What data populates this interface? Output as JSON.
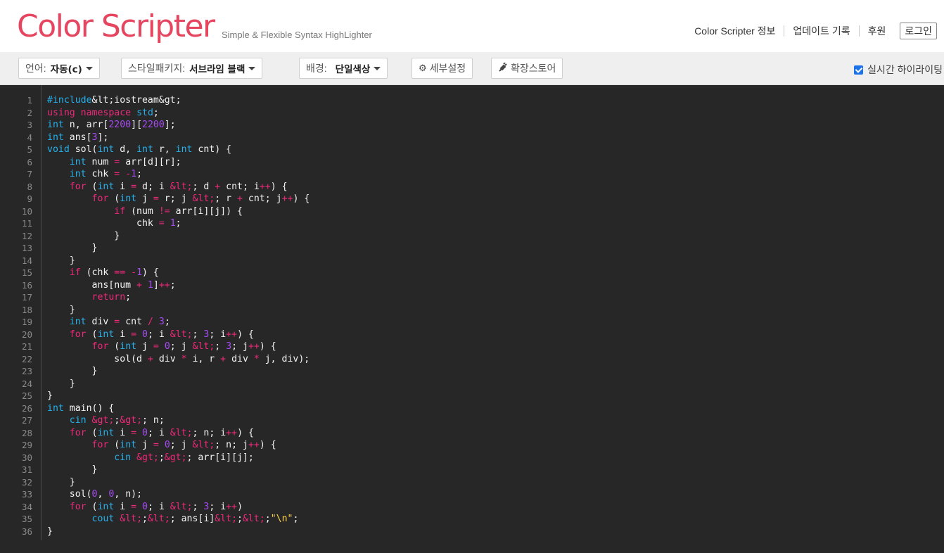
{
  "header": {
    "logo": "Color Scripter",
    "tagline": "Simple & Flexible Syntax HighLighter",
    "nav": [
      "Color Scripter 정보",
      "업데이트 기록",
      "후원"
    ],
    "login": "로그인"
  },
  "toolbar": {
    "language_label": "언어:",
    "language_value": "자동(c)",
    "style_label": "스타일패키지:",
    "style_value": "서브라임 블랙",
    "background_label": "배경:",
    "background_value": "단일색상",
    "details_label": "세부설정",
    "extension_label": "확장스토어",
    "realtime_label": "실시간 하이라이팅",
    "realtime_checked": true
  },
  "colors": {
    "brand": "#e6455f",
    "code_bg": "#272727",
    "keyword": "#f0287b",
    "type": "#26b1ec",
    "number": "#a64bf4",
    "string": "#ffd34d"
  },
  "code": {
    "line_count": 36,
    "lines": [
      [
        [
          "pp",
          "#include"
        ],
        [
          "",
          "&lt;iostream&gt;"
        ]
      ],
      [
        [
          "kw",
          "using"
        ],
        [
          "",
          " "
        ],
        [
          "kw",
          "namespace"
        ],
        [
          "",
          " "
        ],
        [
          "ty",
          "std"
        ],
        [
          "",
          ";"
        ]
      ],
      [
        [
          "ty",
          "int"
        ],
        [
          "",
          " n, arr["
        ],
        [
          "nm",
          "2200"
        ],
        [
          "",
          "]["
        ],
        [
          "nm",
          "2200"
        ],
        [
          "",
          "];"
        ]
      ],
      [
        [
          "ty",
          "int"
        ],
        [
          "",
          " ans["
        ],
        [
          "nm",
          "3"
        ],
        [
          "",
          "];"
        ]
      ],
      [
        [
          "ty",
          "void"
        ],
        [
          "",
          " sol("
        ],
        [
          "ty",
          "int"
        ],
        [
          "",
          " d, "
        ],
        [
          "ty",
          "int"
        ],
        [
          "",
          " r, "
        ],
        [
          "ty",
          "int"
        ],
        [
          "",
          " cnt) {"
        ]
      ],
      [
        [
          "",
          "    "
        ],
        [
          "ty",
          "int"
        ],
        [
          "",
          " num "
        ],
        [
          "op",
          "="
        ],
        [
          "",
          " arr[d][r];"
        ]
      ],
      [
        [
          "",
          "    "
        ],
        [
          "ty",
          "int"
        ],
        [
          "",
          " chk "
        ],
        [
          "op",
          "="
        ],
        [
          "",
          " "
        ],
        [
          "op",
          "-"
        ],
        [
          "nm",
          "1"
        ],
        [
          "",
          ";"
        ]
      ],
      [
        [
          "",
          "    "
        ],
        [
          "kw",
          "for"
        ],
        [
          "",
          " ("
        ],
        [
          "ty",
          "int"
        ],
        [
          "",
          " i "
        ],
        [
          "op",
          "="
        ],
        [
          "",
          " d; i "
        ],
        [
          "op",
          "&lt;"
        ],
        [
          "",
          ";"
        ],
        [
          "",
          " d "
        ],
        [
          "op",
          "+"
        ],
        [
          "",
          " cnt; i"
        ],
        [
          "op",
          "++"
        ],
        [
          "",
          ") {"
        ]
      ],
      [
        [
          "",
          "        "
        ],
        [
          "kw",
          "for"
        ],
        [
          "",
          " ("
        ],
        [
          "ty",
          "int"
        ],
        [
          "",
          " j "
        ],
        [
          "op",
          "="
        ],
        [
          "",
          " r; j "
        ],
        [
          "op",
          "&lt;"
        ],
        [
          "",
          "; r "
        ],
        [
          "op",
          "+"
        ],
        [
          "",
          " cnt; j"
        ],
        [
          "op",
          "++"
        ],
        [
          "",
          ") {"
        ]
      ],
      [
        [
          "",
          "            "
        ],
        [
          "kw",
          "if"
        ],
        [
          "",
          " (num "
        ],
        [
          "op",
          "!="
        ],
        [
          "",
          " arr[i][j]) {"
        ]
      ],
      [
        [
          "",
          "                chk "
        ],
        [
          "op",
          "="
        ],
        [
          "",
          " "
        ],
        [
          "nm",
          "1"
        ],
        [
          "",
          ";"
        ]
      ],
      [
        [
          "",
          "            }"
        ]
      ],
      [
        [
          "",
          "        }"
        ]
      ],
      [
        [
          "",
          "    }"
        ]
      ],
      [
        [
          "",
          "    "
        ],
        [
          "kw",
          "if"
        ],
        [
          "",
          " (chk "
        ],
        [
          "op",
          "=="
        ],
        [
          "",
          " "
        ],
        [
          "op",
          "-"
        ],
        [
          "nm",
          "1"
        ],
        [
          "",
          ") {"
        ]
      ],
      [
        [
          "",
          "        ans[num "
        ],
        [
          "op",
          "+"
        ],
        [
          "",
          " "
        ],
        [
          "nm",
          "1"
        ],
        [
          "",
          "]"
        ],
        [
          "op",
          "++"
        ],
        [
          "",
          ";"
        ]
      ],
      [
        [
          "",
          "        "
        ],
        [
          "kw",
          "return"
        ],
        [
          "",
          ";"
        ]
      ],
      [
        [
          "",
          "    }"
        ]
      ],
      [
        [
          "",
          "    "
        ],
        [
          "ty",
          "int"
        ],
        [
          "",
          " div "
        ],
        [
          "op",
          "="
        ],
        [
          "",
          " cnt "
        ],
        [
          "op",
          "/"
        ],
        [
          "",
          " "
        ],
        [
          "nm",
          "3"
        ],
        [
          "",
          ";"
        ]
      ],
      [
        [
          "",
          "    "
        ],
        [
          "kw",
          "for"
        ],
        [
          "",
          " ("
        ],
        [
          "ty",
          "int"
        ],
        [
          "",
          " i "
        ],
        [
          "op",
          "="
        ],
        [
          "",
          " "
        ],
        [
          "nm",
          "0"
        ],
        [
          "",
          "; i "
        ],
        [
          "op",
          "&lt;"
        ],
        [
          "",
          "; "
        ],
        [
          "nm",
          "3"
        ],
        [
          "",
          "; i"
        ],
        [
          "op",
          "++"
        ],
        [
          "",
          ") {"
        ]
      ],
      [
        [
          "",
          "        "
        ],
        [
          "kw",
          "for"
        ],
        [
          "",
          " ("
        ],
        [
          "ty",
          "int"
        ],
        [
          "",
          " j "
        ],
        [
          "op",
          "="
        ],
        [
          "",
          " "
        ],
        [
          "nm",
          "0"
        ],
        [
          "",
          "; j "
        ],
        [
          "op",
          "&lt;"
        ],
        [
          "",
          "; "
        ],
        [
          "nm",
          "3"
        ],
        [
          "",
          "; j"
        ],
        [
          "op",
          "++"
        ],
        [
          "",
          ") {"
        ]
      ],
      [
        [
          "",
          "            sol(d "
        ],
        [
          "op",
          "+"
        ],
        [
          "",
          " div "
        ],
        [
          "op",
          "*"
        ],
        [
          "",
          " i, r "
        ],
        [
          "op",
          "+"
        ],
        [
          "",
          " div "
        ],
        [
          "op",
          "*"
        ],
        [
          "",
          " j, div);"
        ]
      ],
      [
        [
          "",
          "        }"
        ]
      ],
      [
        [
          "",
          "    }"
        ]
      ],
      [
        [
          "",
          "}"
        ]
      ],
      [
        [
          "ty",
          "int"
        ],
        [
          "",
          " main() {"
        ]
      ],
      [
        [
          "",
          "    "
        ],
        [
          "ty",
          "cin"
        ],
        [
          "",
          " "
        ],
        [
          "op",
          "&gt;"
        ],
        [
          "",
          ";"
        ],
        [
          "op",
          "&gt;"
        ],
        [
          "",
          "; n;"
        ]
      ],
      [
        [
          "",
          "    "
        ],
        [
          "kw",
          "for"
        ],
        [
          "",
          " ("
        ],
        [
          "ty",
          "int"
        ],
        [
          "",
          " i "
        ],
        [
          "op",
          "="
        ],
        [
          "",
          " "
        ],
        [
          "nm",
          "0"
        ],
        [
          "",
          "; i "
        ],
        [
          "op",
          "&lt;"
        ],
        [
          "",
          "; n; i"
        ],
        [
          "op",
          "++"
        ],
        [
          "",
          ") {"
        ]
      ],
      [
        [
          "",
          "        "
        ],
        [
          "kw",
          "for"
        ],
        [
          "",
          " ("
        ],
        [
          "ty",
          "int"
        ],
        [
          "",
          " j "
        ],
        [
          "op",
          "="
        ],
        [
          "",
          " "
        ],
        [
          "nm",
          "0"
        ],
        [
          "",
          "; j "
        ],
        [
          "op",
          "&lt;"
        ],
        [
          "",
          "; n; j"
        ],
        [
          "op",
          "++"
        ],
        [
          "",
          ") {"
        ]
      ],
      [
        [
          "",
          "            "
        ],
        [
          "ty",
          "cin"
        ],
        [
          "",
          " "
        ],
        [
          "op",
          "&gt;"
        ],
        [
          "",
          ";"
        ],
        [
          "op",
          "&gt;"
        ],
        [
          "",
          "; arr[i][j];"
        ]
      ],
      [
        [
          "",
          "        }"
        ]
      ],
      [
        [
          "",
          "    }"
        ]
      ],
      [
        [
          "",
          "    sol("
        ],
        [
          "nm",
          "0"
        ],
        [
          "",
          ", "
        ],
        [
          "nm",
          "0"
        ],
        [
          "",
          ", n);"
        ]
      ],
      [
        [
          "",
          "    "
        ],
        [
          "kw",
          "for"
        ],
        [
          "",
          " ("
        ],
        [
          "ty",
          "int"
        ],
        [
          "",
          " i "
        ],
        [
          "op",
          "="
        ],
        [
          "",
          " "
        ],
        [
          "nm",
          "0"
        ],
        [
          "",
          "; i "
        ],
        [
          "op",
          "&lt;"
        ],
        [
          "",
          "; "
        ],
        [
          "nm",
          "3"
        ],
        [
          "",
          "; i"
        ],
        [
          "op",
          "++"
        ],
        [
          "",
          ")"
        ]
      ],
      [
        [
          "",
          "        "
        ],
        [
          "ty",
          "cout"
        ],
        [
          "",
          " "
        ],
        [
          "op",
          "&lt;"
        ],
        [
          "",
          ";"
        ],
        [
          "op",
          "&lt;"
        ],
        [
          "",
          "; ans[i]"
        ],
        [
          "op",
          "&lt;"
        ],
        [
          "",
          ";"
        ],
        [
          "op",
          "&lt;"
        ],
        [
          "",
          ";"
        ],
        [
          "st",
          "\"\\n\""
        ],
        [
          "",
          ";"
        ]
      ],
      [
        [
          "",
          "}"
        ]
      ]
    ]
  }
}
